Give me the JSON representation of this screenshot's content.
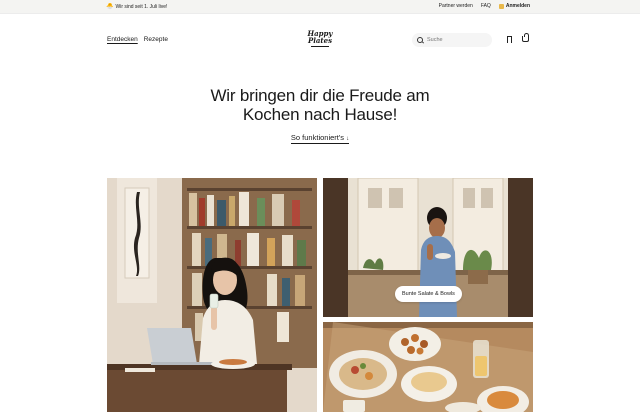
{
  "topbar": {
    "announcement_emoji": "🐣",
    "announcement": "Wir sind seit 1. Juli live!",
    "partner": "Partner werden",
    "faq": "FAQ",
    "login": "Anmelden"
  },
  "nav": {
    "items": [
      {
        "label": "Entdecken",
        "active": true
      },
      {
        "label": "Rezepte",
        "active": false
      }
    ],
    "logo_line1": "Happy",
    "logo_line2": "Plates"
  },
  "search": {
    "placeholder": "Suche"
  },
  "icons": {
    "search": "search-icon",
    "bookmark": "bookmark-icon",
    "cart": "cart-icon"
  },
  "hero": {
    "title_line1": "Wir bringen dir die Freude am",
    "title_line2": "Kochen nach Hause!",
    "cta": "So funktioniert's",
    "cta_arrow": "↓"
  },
  "gallery": {
    "badge": "Bunte Salate & Bowls"
  },
  "colors": {
    "topbar_bg": "#f4f4f2",
    "text": "#1a1a1a",
    "accent": "#e8b84a"
  }
}
